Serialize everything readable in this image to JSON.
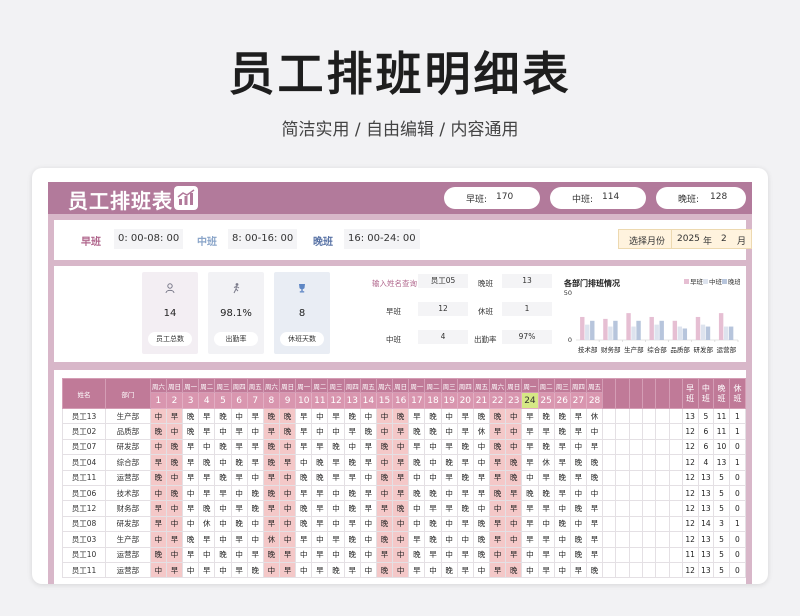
{
  "page": {
    "title": "员工排班明细表",
    "subtitle": "简洁实用 / 自由编辑 / 内容通用"
  },
  "header": {
    "logo": "员工排班表",
    "counts": [
      {
        "label": "早班:",
        "value": "170"
      },
      {
        "label": "中班:",
        "value": "114"
      },
      {
        "label": "晚班:",
        "value": "128"
      }
    ]
  },
  "shifts": [
    {
      "name": "早班",
      "time": "0: 00-08: 00",
      "color": "#b0668c"
    },
    {
      "name": "中班",
      "time": "8: 00-16: 00",
      "color": "#8aa5c9"
    },
    {
      "name": "晚班",
      "time": "16: 00-24: 00",
      "color": "#5a74a6"
    }
  ],
  "month_picker": {
    "label": "选择月份",
    "year": "2025",
    "year_unit": "年",
    "month": "2",
    "month_unit": "月"
  },
  "kpis": [
    {
      "icon": "person-icon",
      "value": "14",
      "label": "员工总数",
      "bg": "#f3eef3"
    },
    {
      "icon": "runner-icon",
      "value": "98.1%",
      "label": "出勤率",
      "bg": "#f2f2f5"
    },
    {
      "icon": "trophy-icon",
      "value": "8",
      "label": "休班天数",
      "bg": "#e9edf4"
    }
  ],
  "query": {
    "prompt": "输入姓名查询",
    "name": "员工05",
    "rows": [
      [
        {
          "k": "晚班",
          "v": "13"
        }
      ],
      [
        {
          "k": "早班",
          "v": "12"
        },
        {
          "k": "休班",
          "v": "1"
        }
      ],
      [
        {
          "k": "中班",
          "v": "4"
        },
        {
          "k": "出勤率",
          "v": "97%"
        }
      ]
    ]
  },
  "chart_data": {
    "type": "bar",
    "title": "各部门排班情况",
    "categories": [
      "技术部",
      "财务部",
      "生产部",
      "综合部",
      "品质部",
      "研发部",
      "运营部"
    ],
    "series": [
      {
        "name": "早班",
        "color": "#e6bfd3",
        "values": [
          24,
          22,
          28,
          24,
          20,
          24,
          28
        ]
      },
      {
        "name": "中班",
        "color": "#dde3ee",
        "values": [
          16,
          14,
          14,
          16,
          14,
          16,
          14
        ]
      },
      {
        "name": "晚班",
        "color": "#b7c5dc",
        "values": [
          20,
          20,
          20,
          20,
          12,
          14,
          14
        ]
      }
    ],
    "ylim": [
      0,
      50
    ],
    "yticks": [
      "50",
      "0"
    ],
    "legend": "top-right"
  },
  "table": {
    "headers": {
      "name": "姓名",
      "dept": "部门",
      "early": "早班",
      "mid": "中班",
      "late": "晚班",
      "rest": "休班"
    },
    "weekdays": [
      "周六",
      "周日",
      "周一",
      "周二",
      "周三",
      "周四",
      "周五",
      "周六",
      "周日",
      "周一",
      "周二",
      "周三",
      "周四",
      "周五",
      "周六",
      "周日",
      "周一",
      "周二",
      "周三",
      "周四",
      "周五",
      "周六",
      "周日",
      "周一",
      "周二",
      "周三",
      "周四",
      "周五"
    ],
    "days": [
      "1",
      "2",
      "3",
      "4",
      "5",
      "6",
      "7",
      "8",
      "9",
      "10",
      "11",
      "12",
      "13",
      "14",
      "15",
      "16",
      "17",
      "18",
      "19",
      "20",
      "21",
      "22",
      "23",
      "24",
      "25",
      "26",
      "27",
      "28"
    ],
    "today_index": 23,
    "rows": [
      {
        "name": "员工13",
        "dept": "生产部",
        "s": [
          "中",
          "早",
          "晚",
          "早",
          "晚",
          "中",
          "早",
          "晚",
          "晚",
          "早",
          "中",
          "早",
          "晚",
          "中",
          "中",
          "晚",
          "早",
          "晚",
          "中",
          "早",
          "晚",
          "晚",
          "中",
          "早",
          "晚",
          "晚",
          "早",
          "休"
        ],
        "e": "13",
        "m": "5",
        "l": "11",
        "r": "1"
      },
      {
        "name": "员工02",
        "dept": "品质部",
        "s": [
          "晚",
          "中",
          "晚",
          "早",
          "中",
          "早",
          "中",
          "早",
          "晚",
          "早",
          "中",
          "中",
          "早",
          "晚",
          "中",
          "早",
          "晚",
          "晚",
          "中",
          "早",
          "休",
          "早",
          "中",
          "早",
          "早",
          "晚",
          "早",
          "中"
        ],
        "e": "12",
        "m": "6",
        "l": "11",
        "r": "1"
      },
      {
        "name": "员工07",
        "dept": "研发部",
        "s": [
          "中",
          "晚",
          "早",
          "中",
          "晚",
          "早",
          "早",
          "晚",
          "中",
          "早",
          "早",
          "晚",
          "中",
          "早",
          "晚",
          "中",
          "早",
          "中",
          "早",
          "晚",
          "中",
          "晚",
          "中",
          "早",
          "晚",
          "早",
          "中",
          "早"
        ],
        "e": "12",
        "m": "6",
        "l": "10",
        "r": "0"
      },
      {
        "name": "员工04",
        "dept": "综合部",
        "s": [
          "早",
          "晚",
          "早",
          "晚",
          "中",
          "晚",
          "早",
          "晚",
          "早",
          "中",
          "晚",
          "早",
          "晚",
          "早",
          "中",
          "早",
          "晚",
          "中",
          "晚",
          "早",
          "中",
          "早",
          "晚",
          "早",
          "休",
          "早",
          "晚",
          "晚"
        ],
        "e": "12",
        "m": "4",
        "l": "13",
        "r": "1"
      },
      {
        "name": "员工11",
        "dept": "运营部",
        "s": [
          "晚",
          "中",
          "早",
          "早",
          "晚",
          "早",
          "中",
          "早",
          "中",
          "晚",
          "晚",
          "早",
          "早",
          "中",
          "晚",
          "早",
          "中",
          "中",
          "早",
          "晚",
          "早",
          "早",
          "晚",
          "中",
          "早",
          "晚",
          "早",
          "晚"
        ],
        "e": "12",
        "m": "13",
        "l": "5",
        "r": "0"
      },
      {
        "name": "员工06",
        "dept": "技术部",
        "s": [
          "中",
          "晚",
          "中",
          "早",
          "早",
          "中",
          "晚",
          "晚",
          "中",
          "早",
          "早",
          "中",
          "晚",
          "早",
          "中",
          "早",
          "晚",
          "晚",
          "中",
          "早",
          "早",
          "晚",
          "早",
          "晚",
          "晚",
          "早",
          "中",
          "中"
        ],
        "e": "12",
        "m": "13",
        "l": "5",
        "r": "0"
      },
      {
        "name": "员工12",
        "dept": "财务部",
        "s": [
          "早",
          "中",
          "早",
          "晚",
          "中",
          "早",
          "晚",
          "早",
          "中",
          "晚",
          "早",
          "中",
          "晚",
          "早",
          "早",
          "晚",
          "中",
          "早",
          "早",
          "晚",
          "中",
          "中",
          "早",
          "早",
          "早",
          "中",
          "晚",
          "早"
        ],
        "e": "12",
        "m": "13",
        "l": "5",
        "r": "0"
      },
      {
        "name": "员工08",
        "dept": "研发部",
        "s": [
          "早",
          "中",
          "中",
          "休",
          "中",
          "晚",
          "中",
          "早",
          "中",
          "晚",
          "早",
          "中",
          "早",
          "中",
          "晚",
          "中",
          "中",
          "晚",
          "中",
          "早",
          "晚",
          "早",
          "中",
          "早",
          "中",
          "晚",
          "中",
          "早"
        ],
        "e": "12",
        "m": "14",
        "l": "3",
        "r": "1"
      },
      {
        "name": "员工03",
        "dept": "生产部",
        "s": [
          "中",
          "早",
          "晚",
          "早",
          "中",
          "早",
          "中",
          "休",
          "中",
          "早",
          "中",
          "早",
          "晚",
          "中",
          "晚",
          "中",
          "早",
          "晚",
          "中",
          "中",
          "晚",
          "早",
          "中",
          "早",
          "早",
          "中",
          "晚",
          "早"
        ],
        "e": "12",
        "m": "13",
        "l": "5",
        "r": "0"
      },
      {
        "name": "员工10",
        "dept": "运营部",
        "s": [
          "晚",
          "中",
          "早",
          "中",
          "晚",
          "中",
          "早",
          "晚",
          "早",
          "中",
          "早",
          "中",
          "晚",
          "中",
          "早",
          "中",
          "晚",
          "早",
          "中",
          "早",
          "晚",
          "中",
          "早",
          "中",
          "早",
          "中",
          "晚",
          "早"
        ],
        "e": "11",
        "m": "13",
        "l": "5",
        "r": "0"
      },
      {
        "name": "员工11",
        "dept": "运营部",
        "s": [
          "中",
          "早",
          "中",
          "早",
          "中",
          "早",
          "晚",
          "中",
          "早",
          "中",
          "早",
          "晚",
          "早",
          "中",
          "晚",
          "中",
          "早",
          "中",
          "晚",
          "早",
          "中",
          "早",
          "晚",
          "中",
          "早",
          "中",
          "早",
          "晚"
        ],
        "e": "12",
        "m": "13",
        "l": "5",
        "r": "0"
      }
    ]
  }
}
